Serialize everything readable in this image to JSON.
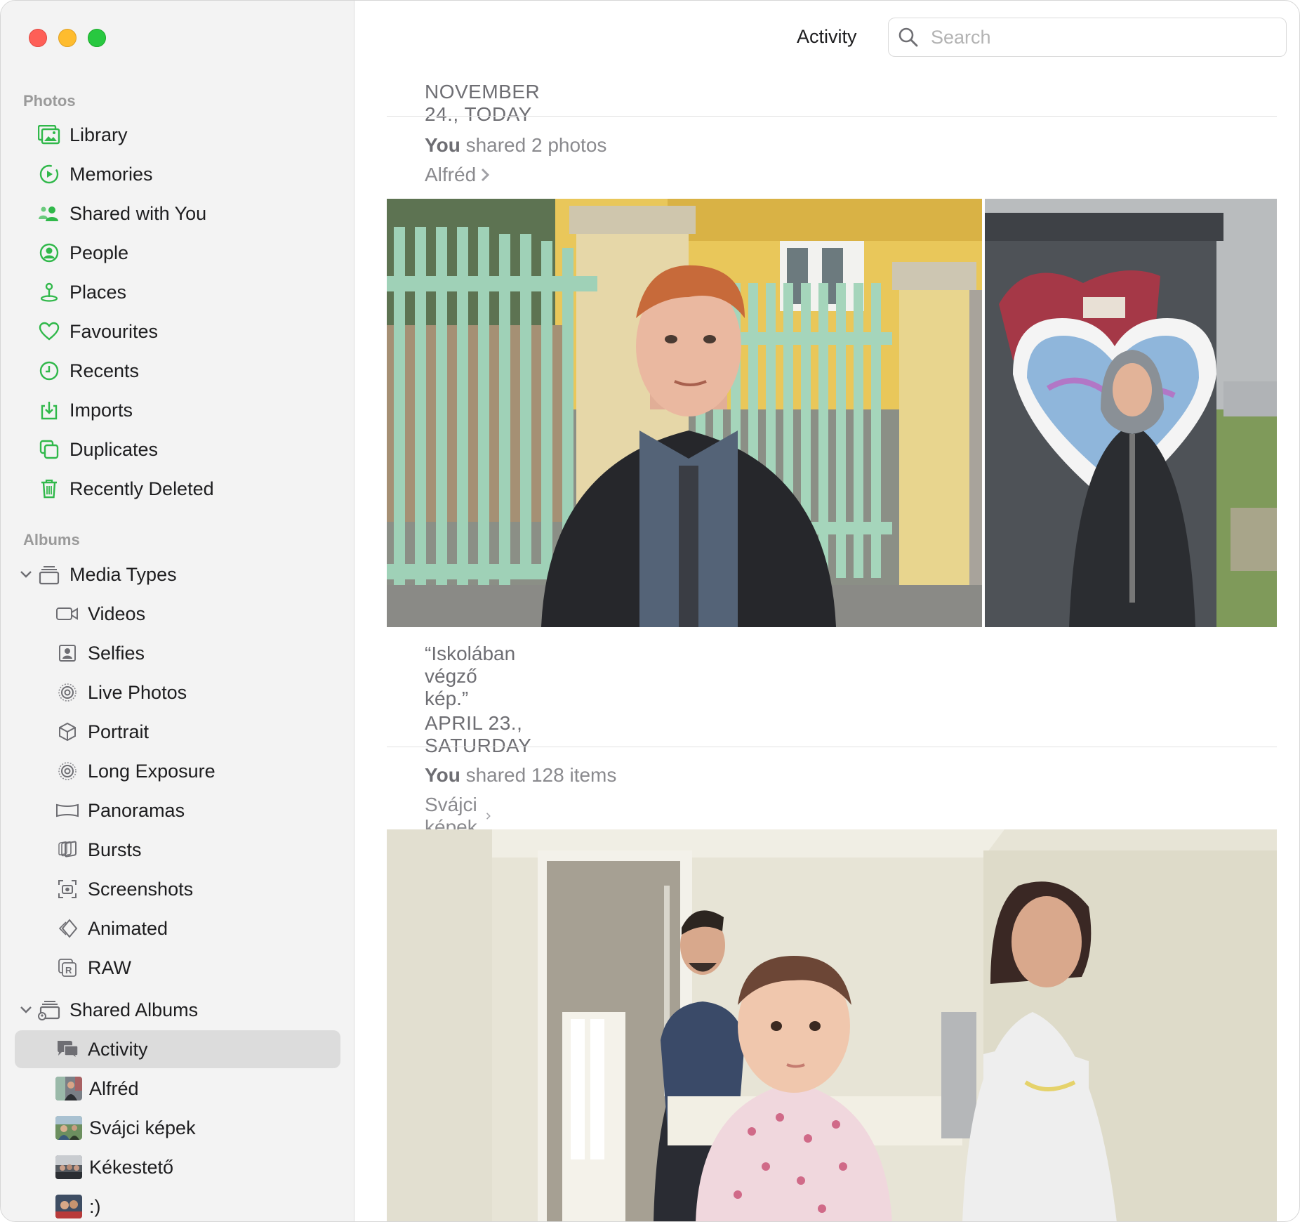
{
  "window": {
    "controls": [
      "close",
      "minimize",
      "zoom"
    ]
  },
  "sidebar": {
    "sections": {
      "photos": "Photos",
      "albums": "Albums"
    },
    "photos_items": [
      {
        "label": "Library",
        "icon": "library-icon"
      },
      {
        "label": "Memories",
        "icon": "memories-icon"
      },
      {
        "label": "Shared with You",
        "icon": "shared-with-you-icon"
      },
      {
        "label": "People",
        "icon": "people-icon"
      },
      {
        "label": "Places",
        "icon": "places-icon"
      },
      {
        "label": "Favourites",
        "icon": "heart-icon"
      },
      {
        "label": "Recents",
        "icon": "clock-icon"
      },
      {
        "label": "Imports",
        "icon": "imports-icon"
      },
      {
        "label": "Duplicates",
        "icon": "duplicates-icon"
      },
      {
        "label": "Recently Deleted",
        "icon": "trash-icon"
      }
    ],
    "media_types": {
      "label": "Media Types",
      "items": [
        {
          "label": "Videos",
          "icon": "video-icon"
        },
        {
          "label": "Selfies",
          "icon": "selfie-icon"
        },
        {
          "label": "Live Photos",
          "icon": "live-photo-icon"
        },
        {
          "label": "Portrait",
          "icon": "portrait-cube-icon"
        },
        {
          "label": "Long Exposure",
          "icon": "long-exposure-icon"
        },
        {
          "label": "Panoramas",
          "icon": "panorama-icon"
        },
        {
          "label": "Bursts",
          "icon": "bursts-icon"
        },
        {
          "label": "Screenshots",
          "icon": "screenshot-icon"
        },
        {
          "label": "Animated",
          "icon": "animated-icon"
        },
        {
          "label": "RAW",
          "icon": "raw-icon"
        }
      ]
    },
    "shared_albums": {
      "label": "Shared Albums",
      "items": [
        {
          "label": "Activity",
          "icon": "activity-icon",
          "selected": true
        },
        {
          "label": "Alfréd",
          "icon": "album-thumb"
        },
        {
          "label": "Svájci képek",
          "icon": "album-thumb"
        },
        {
          "label": "Kékestető",
          "icon": "album-thumb"
        },
        {
          "label": ":)",
          "icon": "album-thumb"
        }
      ]
    }
  },
  "toolbar": {
    "title": "Activity",
    "search_placeholder": "Search"
  },
  "feed": [
    {
      "date": "NOVEMBER 24., TODAY",
      "actor": "You",
      "action": " shared 2 photos",
      "album": "Alfréd",
      "caption": "“Iskolában végző kép.”"
    },
    {
      "date": "APRIL 23., SATURDAY",
      "actor": "You",
      "action": " shared 128 items",
      "album": "Svájci képek"
    }
  ],
  "colors": {
    "accent_green": "#30b84a",
    "selected_bg": "#dcdcdc"
  }
}
